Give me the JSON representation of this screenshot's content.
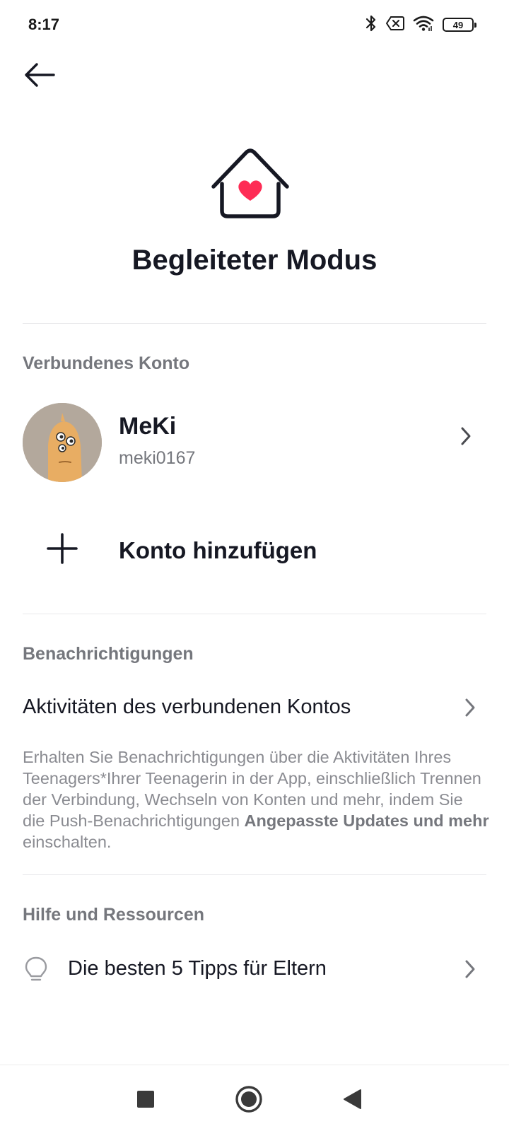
{
  "status_bar": {
    "time": "8:17",
    "battery": "49",
    "icons": [
      "bluetooth-icon",
      "sim-off-icon",
      "wifi-icon",
      "battery-icon"
    ]
  },
  "header": {
    "back_icon": "arrow-left-icon",
    "hero_icon": "house-heart-icon",
    "title": "Begleiteter Modus"
  },
  "connected_account": {
    "section_title": "Verbundenes Konto",
    "account": {
      "name": "MeKi",
      "handle": "meki0167"
    },
    "add_account_label": "Konto hinzufügen"
  },
  "notifications": {
    "section_title": "Benachrichtigungen",
    "item_label": "Aktivitäten des verbundenen Kontos",
    "description_pre": "Erhalten Sie Benachrichtigungen über die Aktivitäten Ihres Teenagers*Ihrer Teenagerin in der App, einschließlich Trennen der Verbindung, Wechseln von Konten und mehr, indem Sie die Push-Benachrichtigungen ",
    "description_bold": "Angepasste Updates und mehr",
    "description_post": " einschalten."
  },
  "help": {
    "section_title": "Hilfe und Ressourcen",
    "item_label": "Die besten 5 Tipps für Eltern"
  },
  "colors": {
    "accent_heart": "#fe2c55",
    "text_primary": "#161823",
    "text_secondary": "#75777d",
    "divider": "#e8e8ea"
  }
}
